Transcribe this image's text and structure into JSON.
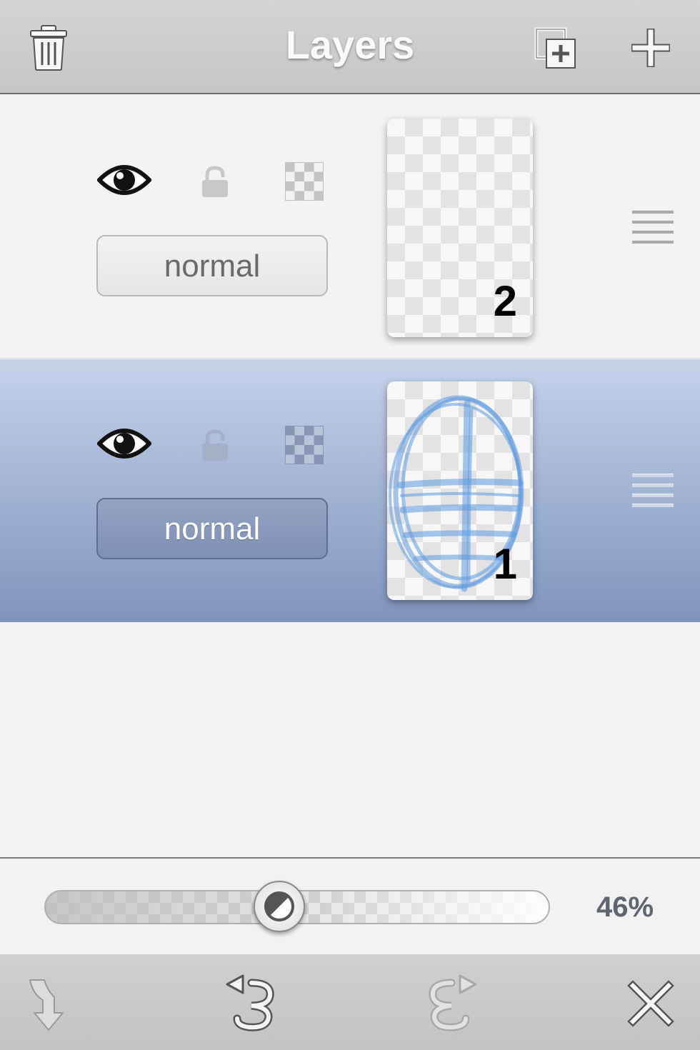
{
  "header": {
    "title": "Layers",
    "delete_icon": "trash-icon",
    "duplicate_icon": "duplicate-layer-icon",
    "add_icon": "plus-icon"
  },
  "layers": [
    {
      "number": "2",
      "blend_mode": "normal",
      "visible": true,
      "locked": false,
      "selected": false
    },
    {
      "number": "1",
      "blend_mode": "normal",
      "visible": true,
      "locked": false,
      "selected": true
    }
  ],
  "opacity": {
    "value_text": "46%",
    "value": 0.46
  },
  "toolbar": {
    "icons": [
      "merge-down-icon",
      "undo-icon",
      "redo-icon",
      "close-icon"
    ]
  },
  "colors": {
    "selected_row_top": "#c5d3ea",
    "selected_row_bottom": "#7f94bd",
    "sketch_stroke": "#5e9be0"
  }
}
